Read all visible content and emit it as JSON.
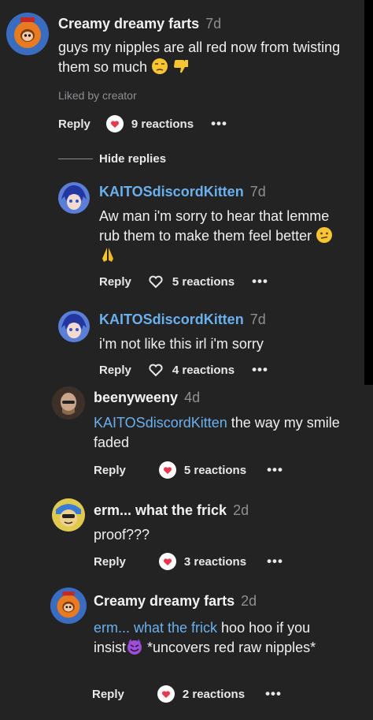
{
  "colors": {
    "background": "#232324",
    "mention": "#6ab0ee",
    "muted": "#8f8f93",
    "heart": "#e8384f"
  },
  "comments": [
    {
      "username": "Creamy dreamy farts",
      "age": "7d",
      "text": "guys my nipples are all red now from twisting them so much",
      "emojis": [
        "unamused-face",
        "thumbs-down"
      ],
      "liked_by": "Liked by creator",
      "reply_label": "Reply",
      "reaction_icon": "heart-filled-icon",
      "reactions": "9 reactions",
      "more": "•••"
    },
    {
      "username": "KAITOSdiscordKitten",
      "age": "7d",
      "text": "Aw man i'm sorry to hear that lemme rub them to make them feel better",
      "emojis": [
        "confused-face",
        "folded-hands"
      ],
      "reply_label": "Reply",
      "reaction_icon": "heart-outline-icon",
      "reactions": "5 reactions",
      "more": "•••"
    },
    {
      "username": "KAITOSdiscordKitten",
      "age": "7d",
      "text": "i'm not like this irl i'm sorry",
      "reply_label": "Reply",
      "reaction_icon": "heart-outline-icon",
      "reactions": "4 reactions",
      "more": "•••"
    },
    {
      "username": "beenyweeny",
      "age": "4d",
      "mention": "KAITOSdiscordKitten",
      "text": " the way my smile faded",
      "reply_label": "Reply",
      "reaction_icon": "heart-filled-icon",
      "reactions": "5 reactions",
      "more": "•••"
    },
    {
      "username": "erm... what the frick",
      "age": "2d",
      "text": "proof???",
      "reply_label": "Reply",
      "reaction_icon": "heart-filled-icon",
      "reactions": "3 reactions",
      "more": "•••"
    },
    {
      "username": "Creamy dreamy farts",
      "age": "2d",
      "mention": "erm... what the frick",
      "text_before_emoji": " hoo hoo if you insist",
      "emojis": [
        "smiling-devil"
      ],
      "text_after_emoji": " *uncovers red raw nipples*",
      "reply_label": "Reply",
      "reaction_icon": "heart-filled-icon",
      "reactions": "2 reactions",
      "more": "•••"
    }
  ],
  "thread": {
    "hide_replies_label": "Hide replies"
  }
}
